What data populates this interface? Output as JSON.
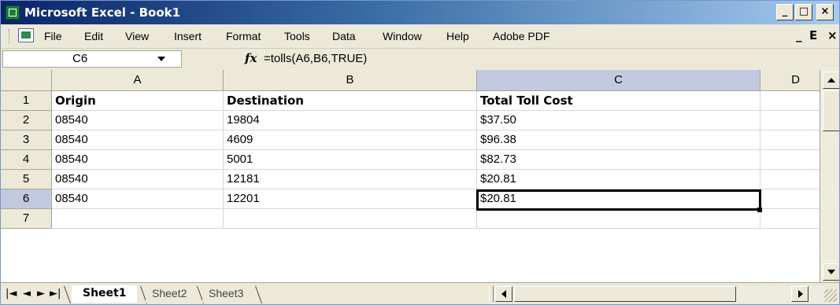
{
  "window": {
    "title": "Microsoft Excel - Book1",
    "minimize": "_",
    "maximize": "□",
    "close": "×"
  },
  "menu": {
    "items": [
      "File",
      "Edit",
      "View",
      "Insert",
      "Format",
      "Tools",
      "Data",
      "Window",
      "Help",
      "Adobe PDF"
    ],
    "doc_minimize": "_",
    "doc_restore": "ⴹ",
    "doc_close": "×"
  },
  "formula_bar": {
    "name_box": "C6",
    "fx_label": "fx",
    "formula": "=tolls(A6,B6,TRUE)"
  },
  "grid": {
    "columns": [
      "A",
      "B",
      "C",
      "D"
    ],
    "selected_column": "C",
    "rows": [
      {
        "num": "1",
        "cells": [
          "Origin",
          "Destination",
          "Total Toll Cost"
        ],
        "header": true
      },
      {
        "num": "2",
        "cells": [
          "08540",
          "19804",
          "$37.50"
        ]
      },
      {
        "num": "3",
        "cells": [
          "08540",
          "4609",
          "$96.38"
        ]
      },
      {
        "num": "4",
        "cells": [
          "08540",
          "5001",
          "$82.73"
        ]
      },
      {
        "num": "5",
        "cells": [
          "08540",
          "12181",
          "$20.81"
        ]
      },
      {
        "num": "6",
        "cells": [
          "08540",
          "12201",
          "$20.81"
        ]
      },
      {
        "num": "7",
        "cells": [
          "",
          "",
          ""
        ]
      }
    ],
    "active_cell": "C6"
  },
  "sheets": {
    "nav": [
      "|◄",
      "◄",
      "►",
      "►|"
    ],
    "tabs": [
      "Sheet1",
      "Sheet2",
      "Sheet3"
    ],
    "active": "Sheet1"
  }
}
